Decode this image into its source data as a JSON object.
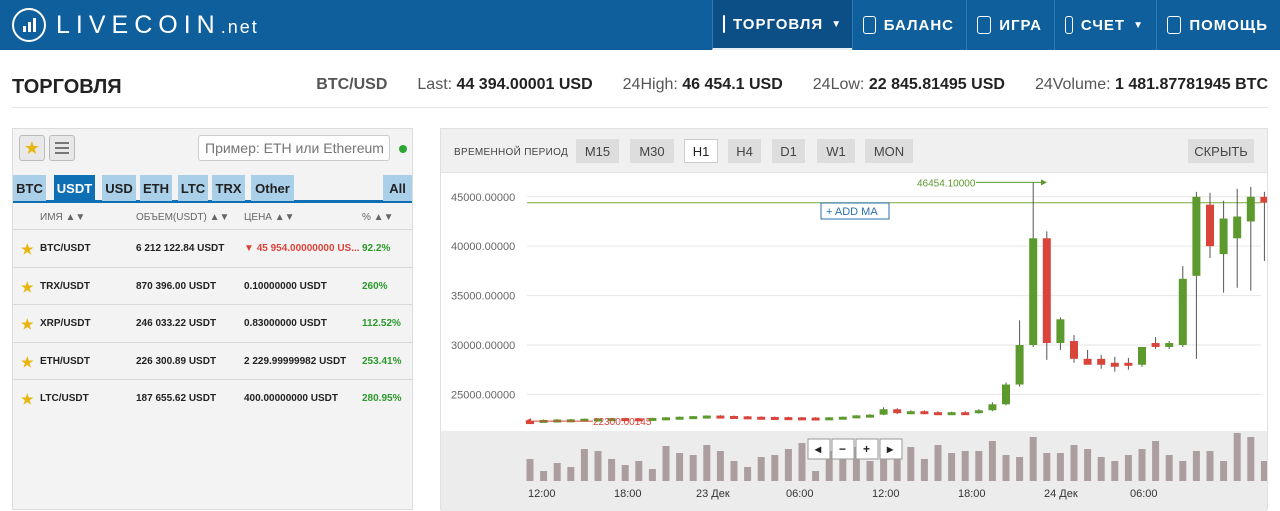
{
  "brand": {
    "name": "LIVECOIN",
    "suffix": ".net"
  },
  "nav": [
    {
      "label": "ТОРГОВЛЯ",
      "icon": "chart-icon",
      "caret": true,
      "active": true
    },
    {
      "label": "БАЛАНС",
      "icon": "wallet-icon",
      "caret": false
    },
    {
      "label": "ИГРА",
      "icon": "dice-icon",
      "caret": false
    },
    {
      "label": "СЧЕТ",
      "icon": "account-icon",
      "caret": true
    },
    {
      "label": "ПОМОЩЬ",
      "icon": "help-icon",
      "caret": false
    }
  ],
  "page": {
    "title": "ТОРГОВЛЯ",
    "pair": "BTC/USD",
    "last_label": "Last:",
    "last_value": "44 394.00001 USD",
    "high_label": "24High:",
    "high_value": "46 454.1 USD",
    "low_label": "24Low:",
    "low_value": "22 845.81495 USD",
    "volume_label": "24Volume:",
    "volume_value": "1 481.87781945 BTC"
  },
  "markets": {
    "search_placeholder": "Пример: ETH или Ethereum",
    "tabs": [
      "BTC",
      "USDT",
      "USD",
      "ETH",
      "LTC",
      "TRX",
      "Other",
      "All"
    ],
    "active_tab": "USDT",
    "columns": [
      "ИМЯ ▲▼",
      "ОБЪЕМ(USDT) ▲▼",
      "ЦЕНА ▲▼",
      "% ▲▼"
    ],
    "rows": [
      {
        "name": "BTC/USDT",
        "volume": "6 212 122.84 USDT",
        "price": "45 954.00000000 US...",
        "change": "92.2%",
        "down": true
      },
      {
        "name": "TRX/USDT",
        "volume": "870 396.00 USDT",
        "price": "0.10000000 USDT",
        "change": "260%",
        "down": false
      },
      {
        "name": "XRP/USDT",
        "volume": "246 033.22 USDT",
        "price": "0.83000000 USDT",
        "change": "112.52%",
        "down": false
      },
      {
        "name": "ETH/USDT",
        "volume": "226 300.89 USDT",
        "price": "2 229.99999982 USDT",
        "change": "253.41%",
        "down": false
      },
      {
        "name": "LTC/USDT",
        "volume": "187 655.62 USDT",
        "price": "400.00000000 USDT",
        "change": "280.95%",
        "down": false
      }
    ]
  },
  "chart_controls": {
    "period_label": "ВРЕМЕННОЙ ПЕРИОД",
    "timeframes": [
      "M15",
      "M30",
      "H1",
      "H4",
      "D1",
      "W1",
      "MON"
    ],
    "active_timeframe": "H1",
    "hide_label": "СКРЫТЬ",
    "add_ma_label": "+ ADD MA",
    "zoom_buttons": [
      "◂",
      "−",
      "+",
      "▸"
    ]
  },
  "chart_data": {
    "type": "candlestick",
    "y_ticks": [
      "45000.00000",
      "40000.00000",
      "35000.00000",
      "30000.00000",
      "25000.00000"
    ],
    "y_tick_values": [
      45000,
      40000,
      35000,
      30000,
      25000
    ],
    "ylim": [
      21500,
      47000
    ],
    "x_ticks": [
      "12:00",
      "18:00",
      "23 Дек",
      "06:00",
      "12:00",
      "18:00",
      "24 Дек",
      "06:00"
    ],
    "max_annotation": "46454.10000",
    "max_value": 46454.1,
    "min_annotation": "22300.00145",
    "min_value": 22300,
    "current_line": 44394,
    "colors": {
      "up": "#5d9a2d",
      "down": "#d9443b",
      "volume": "#ac9e9e",
      "line": "#7aa83a"
    },
    "candles": [
      [
        22300,
        22350,
        22250,
        22290
      ],
      [
        22300,
        22450,
        22280,
        22420
      ],
      [
        22420,
        22500,
        22380,
        22460
      ],
      [
        22460,
        22520,
        22420,
        22480
      ],
      [
        22480,
        22560,
        22450,
        22540
      ],
      [
        22540,
        22600,
        22500,
        22560
      ],
      [
        22560,
        22620,
        22520,
        22600
      ],
      [
        22600,
        22640,
        22550,
        22580
      ],
      [
        22580,
        22620,
        22520,
        22560
      ],
      [
        22560,
        22640,
        22540,
        22620
      ],
      [
        22620,
        22700,
        22600,
        22680
      ],
      [
        22680,
        22760,
        22650,
        22740
      ],
      [
        22740,
        22820,
        22700,
        22800
      ],
      [
        22800,
        22880,
        22760,
        22860
      ],
      [
        22860,
        22900,
        22800,
        22820
      ],
      [
        22820,
        22860,
        22760,
        22780
      ],
      [
        22780,
        22820,
        22720,
        22740
      ],
      [
        22740,
        22780,
        22700,
        22720
      ],
      [
        22720,
        22760,
        22680,
        22700
      ],
      [
        22700,
        22740,
        22660,
        22680
      ],
      [
        22680,
        22720,
        22640,
        22660
      ],
      [
        22660,
        22700,
        22620,
        22640
      ],
      [
        22640,
        22700,
        22620,
        22680
      ],
      [
        22680,
        22760,
        22660,
        22740
      ],
      [
        22740,
        22900,
        22720,
        22880
      ],
      [
        22880,
        23000,
        22850,
        22950
      ],
      [
        22950,
        23700,
        22900,
        23500
      ],
      [
        23500,
        23600,
        23000,
        23100
      ],
      [
        23100,
        23400,
        23000,
        23300
      ],
      [
        23300,
        23400,
        23100,
        23200
      ],
      [
        23200,
        23300,
        23050,
        23150
      ],
      [
        23150,
        23250,
        23050,
        23200
      ],
      [
        23200,
        23300,
        23050,
        23100
      ],
      [
        23100,
        23500,
        23050,
        23400
      ],
      [
        23400,
        24200,
        23300,
        24000
      ],
      [
        24000,
        26200,
        23900,
        26000
      ],
      [
        26000,
        32500,
        25800,
        30000
      ],
      [
        30000,
        46454,
        29800,
        40800
      ],
      [
        40800,
        41500,
        28500,
        30200
      ],
      [
        30200,
        32800,
        29500,
        32600
      ],
      [
        30400,
        31000,
        28200,
        28600
      ],
      [
        28600,
        29500,
        28100,
        28000
      ],
      [
        28600,
        29000,
        27600,
        28000
      ],
      [
        28200,
        28800,
        27300,
        27800
      ],
      [
        28200,
        28700,
        27500,
        27900
      ],
      [
        28000,
        29800,
        27800,
        29800
      ],
      [
        30200,
        30800,
        29600,
        29800
      ],
      [
        29800,
        30400,
        29600,
        30200
      ],
      [
        30000,
        38000,
        29800,
        36700
      ],
      [
        37000,
        45500,
        28600,
        45000
      ],
      [
        44200,
        45400,
        38800,
        40000
      ],
      [
        39200,
        44600,
        35300,
        42800
      ],
      [
        40800,
        45800,
        35800,
        43000
      ],
      [
        42500,
        46000,
        35500,
        45000
      ],
      [
        45000,
        45500,
        38500,
        44394
      ]
    ],
    "volumes": [
      22,
      10,
      18,
      14,
      32,
      30,
      22,
      16,
      20,
      12,
      35,
      28,
      26,
      36,
      30,
      20,
      14,
      24,
      26,
      32,
      38,
      10,
      30,
      36,
      34,
      20,
      26,
      40,
      34,
      22,
      36,
      28,
      30,
      30,
      40,
      26,
      24,
      44,
      28,
      28,
      36,
      32,
      24,
      20,
      26,
      32,
      40,
      26,
      20,
      30,
      30,
      20,
      48,
      44,
      20
    ]
  }
}
